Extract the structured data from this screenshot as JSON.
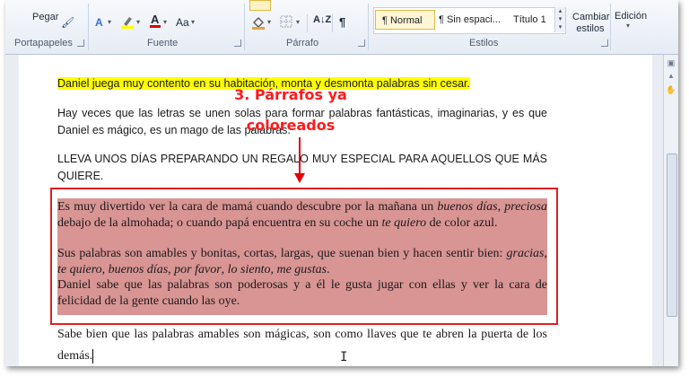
{
  "ribbon": {
    "clipboard": {
      "paste_label": "Pegar",
      "group_label": "Portapapeles"
    },
    "font": {
      "group_label": "Fuente",
      "icons": [
        "text-effects-icon",
        "highlight-icon",
        "font-color-icon",
        "font-size-icon"
      ]
    },
    "paragraph": {
      "group_label": "Párrafo",
      "icons": [
        "shading-icon",
        "borders-icon",
        "sort-icon",
        "show-marks-icon"
      ]
    },
    "styles": {
      "group_label": "Estilos",
      "items": [
        "¶ Normal",
        "¶ Sin espaci...",
        "Título 1"
      ],
      "selected": "¶ Normal",
      "change_label": "Cambiar estilos"
    },
    "editing": {
      "label": "Edición"
    }
  },
  "document": {
    "p1": "Daniel juega muy contento en su habitación, monta y desmonta palabras sin cesar.",
    "p2": "Hay veces que las letras se unen solas para formar palabras fantásticas, imaginarias, y es que Daniel es mágico, es un mago de las palabras.",
    "p3": "LLEVA UNOS DÍAS PREPARANDO UN REGALO MUY ESPECIAL PARA AQUELLOS QUE MÁS QUIERE.",
    "shaded": {
      "s1a": "Es muy divertido ver la cara de mamá cuando descubre por la mañana un ",
      "s1b": "buenos días, preciosa",
      "s1c": " debajo de la almohada; o cuando papá encuentra en su coche un ",
      "s1d": "te quiero",
      "s1e": " de color azul.",
      "s2a": "Sus palabras son amables y bonitas, cortas, largas, que suenan bien y hacen sentir bien: ",
      "s2b": "gracias",
      "s2c": ", ",
      "s2d": "te quiero",
      "s2e": ", ",
      "s2f": "buenos días",
      "s2g": ", ",
      "s2h": "por favor",
      "s2i": ", ",
      "s2j": "lo siento",
      "s2k": ", ",
      "s2l": "me gustas",
      "s2m": ".",
      "s3": "Daniel sabe que las palabras son poderosas y a él le gusta jugar con ellas y ver la cara de felicidad de la gente cuando las oye."
    },
    "p_last": "Sabe bien que las palabras amables son mágicas, son como llaves que te abren la puerta de los demás."
  },
  "annotation": {
    "line1": "3. Párrafos ya",
    "line2": "coloreados"
  },
  "colors": {
    "highlight": "#ffff00",
    "shading": "#d99494",
    "annotation": "#e02020"
  }
}
